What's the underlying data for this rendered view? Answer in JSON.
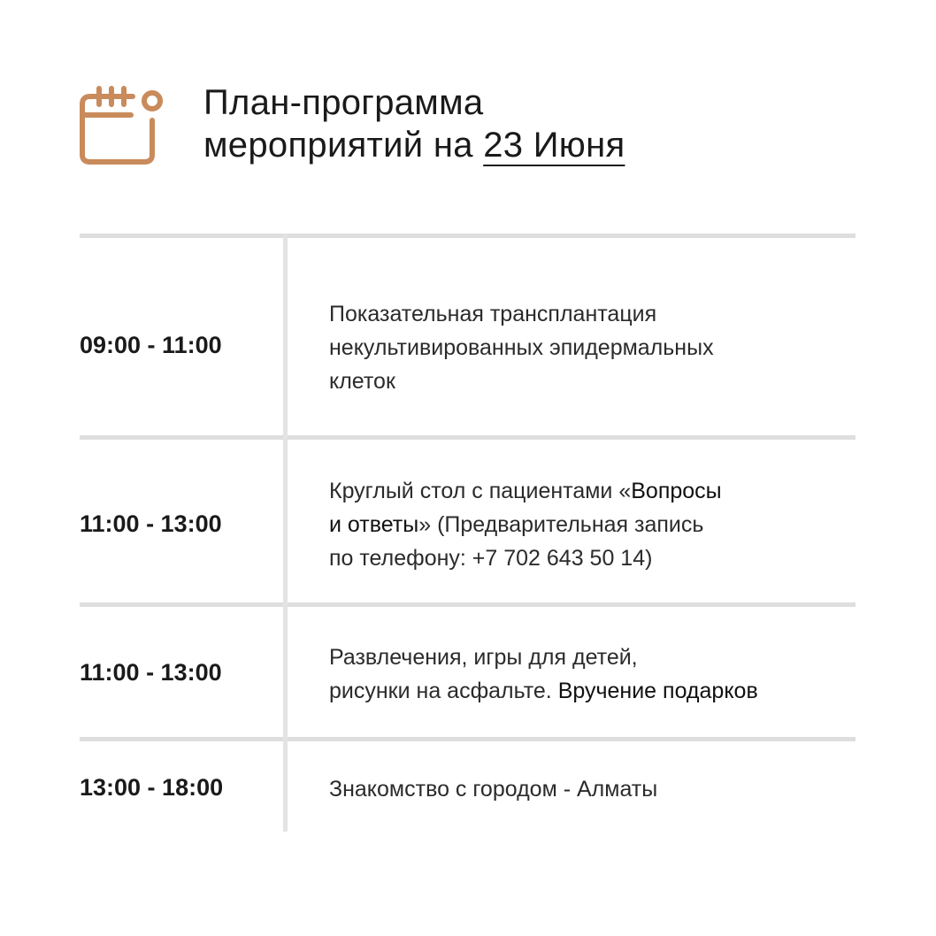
{
  "header": {
    "icon": "calendar-icon",
    "icon_color": "#c98b5b",
    "title_line1": "План-программа",
    "title_line2_prefix": "мероприятий на ",
    "title_date": "23 Июня"
  },
  "schedule": [
    {
      "time": "09:00 - 11:00",
      "lines": [
        "Показательная трансплантация",
        "некультивированных эпидермальных",
        "клеток"
      ]
    },
    {
      "time": "11:00 - 13:00",
      "line1_pre": "Круглый стол с пациентами «",
      "line1_strong": "Вопросы",
      "line2_strong": "и ответы",
      "line2_post": "» (Предварительная запись",
      "line3": "по телефону: +7 702 643 50 14)"
    },
    {
      "time": "11:00 - 13:00",
      "line1": "Развлечения, игры для детей,",
      "line2_pre": "рисунки на асфальте. ",
      "line2_strong": "Вручение подарков"
    },
    {
      "time": "13:00 - 18:00",
      "line1": "Знакомство с городом - Алматы"
    }
  ]
}
